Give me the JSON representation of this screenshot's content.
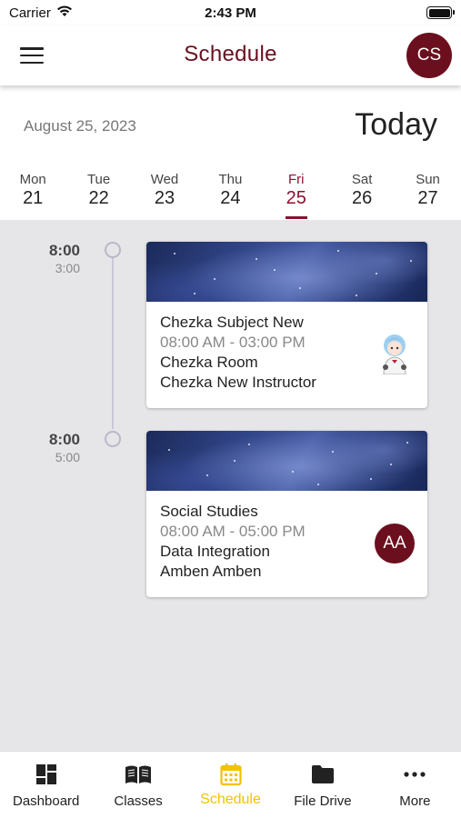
{
  "status_bar": {
    "carrier": "Carrier",
    "time": "2:43 PM"
  },
  "header": {
    "title": "Schedule",
    "avatar_initials": "CS",
    "menu_icon": "hamburger-icon"
  },
  "date_row": {
    "date": "August 25, 2023",
    "today_label": "Today"
  },
  "week": [
    {
      "name": "Mon",
      "num": "21"
    },
    {
      "name": "Tue",
      "num": "22"
    },
    {
      "name": "Wed",
      "num": "23"
    },
    {
      "name": "Thu",
      "num": "24"
    },
    {
      "name": "Fri",
      "num": "25",
      "active": true
    },
    {
      "name": "Sat",
      "num": "26"
    },
    {
      "name": "Sun",
      "num": "27"
    }
  ],
  "events": [
    {
      "start": "8:00",
      "end": "3:00",
      "title": "Chezka Subject New",
      "time_range": "08:00 AM - 03:00 PM",
      "room": "Chezka Room",
      "instructor": "Chezka New Instructor",
      "avatar": "anime-avatar-image"
    },
    {
      "start": "8:00",
      "end": "5:00",
      "title": "Social Studies",
      "time_range": "08:00 AM - 05:00 PM",
      "room": "Data Integration",
      "instructor": "Amben Amben",
      "avatar_initials": "AA"
    }
  ],
  "bottom_nav": [
    {
      "label": "Dashboard",
      "icon": "dashboard-icon"
    },
    {
      "label": "Classes",
      "icon": "book-icon"
    },
    {
      "label": "Schedule",
      "icon": "calendar-icon",
      "active": true
    },
    {
      "label": "File Drive",
      "icon": "folder-icon"
    },
    {
      "label": "More",
      "icon": "more-dots-icon"
    }
  ],
  "colors": {
    "brand": "#6b0f1f",
    "active_day": "#8a1030",
    "active_nav": "#f2c200",
    "schedule_bg": "#e6e6e9"
  }
}
